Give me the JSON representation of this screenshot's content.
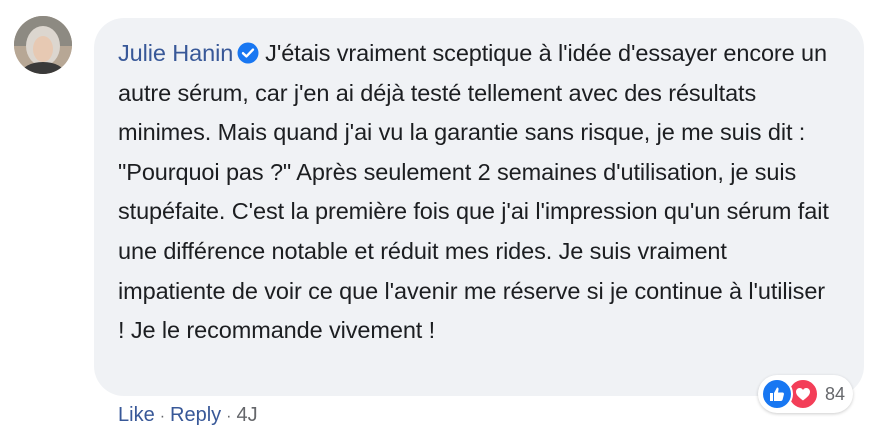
{
  "comment": {
    "author": "Julie Hanin",
    "text": "J'étais vraiment sceptique à l'idée d'essayer encore un autre sérum, car j'en ai déjà testé tellement avec des résultats minimes. Mais quand j'ai vu la garantie sans risque, je me suis dit : \"Pourquoi pas ?\" Après seulement 2 semaines d'utilisation, je suis stupéfaite. C'est la première fois que j'ai l'impression qu'un sérum fait une différence notable et réduit mes rides. Je suis vraiment impatiente de voir ce que l'avenir me réserve si je continue à l'utiliser ! Je le recommande vivement !",
    "verified_icon": "verified-badge-icon"
  },
  "reactions": {
    "icons": [
      "like-icon",
      "heart-icon"
    ],
    "count": "84"
  },
  "actions": {
    "like_label": "Like",
    "separator": "·",
    "reply_label": "Reply",
    "time": "4J"
  },
  "colors": {
    "author": "#385898",
    "bubble": "#f0f2f5",
    "like": "#1877f2",
    "love": "#f33e58"
  }
}
